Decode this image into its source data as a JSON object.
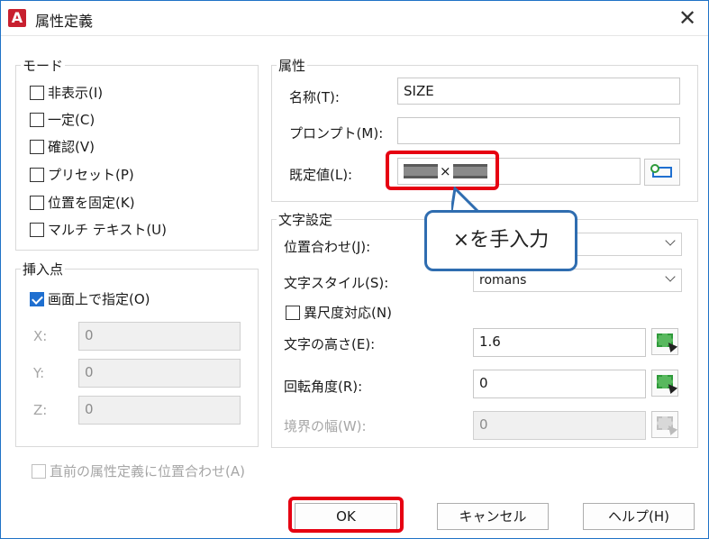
{
  "window": {
    "title": "属性定義",
    "app_icon": "A",
    "close_glyph": "✕"
  },
  "mode": {
    "label": "モード",
    "items": [
      {
        "label": "非表示(I)",
        "checked": false
      },
      {
        "label": "一定(C)",
        "checked": false
      },
      {
        "label": "確認(V)",
        "checked": false
      },
      {
        "label": "プリセット(P)",
        "checked": false
      },
      {
        "label": "位置を固定(K)",
        "checked": false
      },
      {
        "label": "マルチ テキスト(U)",
        "checked": false
      }
    ]
  },
  "insertion": {
    "label": "挿入点",
    "specify_on_screen": {
      "label": "画面上で指定(O)",
      "checked": true
    },
    "x": {
      "label": "X:",
      "value": "0"
    },
    "y": {
      "label": "Y:",
      "value": "0"
    },
    "z": {
      "label": "Z:",
      "value": "0"
    }
  },
  "attribute": {
    "label": "属性",
    "tag": {
      "label": "名称(T):",
      "value": "SIZE"
    },
    "prompt": {
      "label": "プロンプト(M):",
      "value": ""
    },
    "default": {
      "label": "既定値(L):",
      "separator": "×"
    }
  },
  "text_settings": {
    "label": "文字設定",
    "justification": {
      "label": "位置合わせ(J):",
      "value": ""
    },
    "text_style": {
      "label": "文字スタイル(S):",
      "value": "romans"
    },
    "annotative": {
      "label": "異尺度対応(N)",
      "checked": false
    },
    "text_height": {
      "label": "文字の高さ(E):",
      "value": "1.6"
    },
    "rotation": {
      "label": "回転角度(R):",
      "value": "0"
    },
    "boundary_width": {
      "label": "境界の幅(W):",
      "value": "0"
    }
  },
  "align_below": {
    "label": "直前の属性定義に位置合わせ(A)",
    "checked": false
  },
  "buttons": {
    "ok": "OK",
    "cancel": "キャンセル",
    "help": "ヘルプ(H)"
  },
  "annotation": {
    "callout_text": "×を手入力",
    "highlight_color": "#e60012",
    "callout_border_color": "#2f6db0"
  }
}
